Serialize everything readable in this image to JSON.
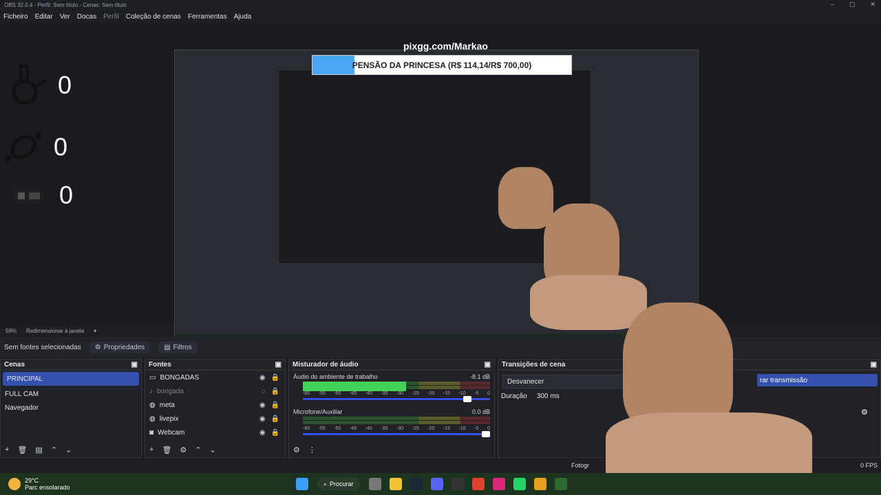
{
  "window": {
    "title": "OBS 32.0.4 - Perfil: Sem título - Cenas: Sem título"
  },
  "menu": [
    "Ficheiro",
    "Editar",
    "Ver",
    "Docas",
    "Perfil",
    "Coleção de cenas",
    "Ferramentas",
    "Ajuda"
  ],
  "overlay": {
    "watermark": "pixgg.com/Markao",
    "goal_text": "PENSÃO DA PRINCESA (R$ 114,14/R$ 700,00)",
    "goal_progress": 0.163,
    "counters": [
      {
        "icon": "bong-icon",
        "value": "0"
      },
      {
        "icon": "candy-icon",
        "value": "0"
      },
      {
        "icon": "livepix-icon",
        "value": "0"
      }
    ]
  },
  "status": {
    "zoom": "59%",
    "resize": "Redimensionar à janela"
  },
  "toolbar": {
    "no_source": "Sem fontes selecionadas",
    "properties": "Propriedades",
    "filters": "Filtros"
  },
  "scenes": {
    "title": "Cenas",
    "items": [
      "PRINCIPAL",
      "FULL CAM",
      "Navegador"
    ],
    "selected": 0
  },
  "sources": {
    "title": "Fontes",
    "items": [
      {
        "name": "BONGADAS",
        "icon": "window-icon",
        "visible": true
      },
      {
        "name": "bongada",
        "icon": "audio-icon",
        "visible": false
      },
      {
        "name": "meta",
        "icon": "browser-icon",
        "visible": true
      },
      {
        "name": "livepix",
        "icon": "browser-icon",
        "visible": true
      },
      {
        "name": "Webcam",
        "icon": "camera-icon",
        "visible": true
      }
    ]
  },
  "mixer": {
    "title": "Misturador de áudio",
    "channels": [
      {
        "name": "Áudio do ambiente de trabalho",
        "db": "-8.1 dB",
        "level": 0.55,
        "volume": 0.9
      },
      {
        "name": "Microfone/Auxiliar",
        "db": "0.0 dB",
        "level": 0.0,
        "volume": 1.0
      }
    ],
    "ticks": [
      "-60",
      "-55",
      "-50",
      "-45",
      "-40",
      "-35",
      "-30",
      "-25",
      "-20",
      "-15",
      "-10",
      "-5",
      "0"
    ]
  },
  "transitions": {
    "title": "Transições de cena",
    "selected": "Desvanecer",
    "duration_label": "Duração",
    "duration": "300 ms"
  },
  "controls": {
    "partial_label": "rar transmissão"
  },
  "statusbar": {
    "partial_photo": "Fotogr",
    "partial_fps": "0 FPS"
  },
  "taskbar": {
    "temp": "29°C",
    "condition": "Parc ensolarado",
    "search": "Procurar"
  }
}
